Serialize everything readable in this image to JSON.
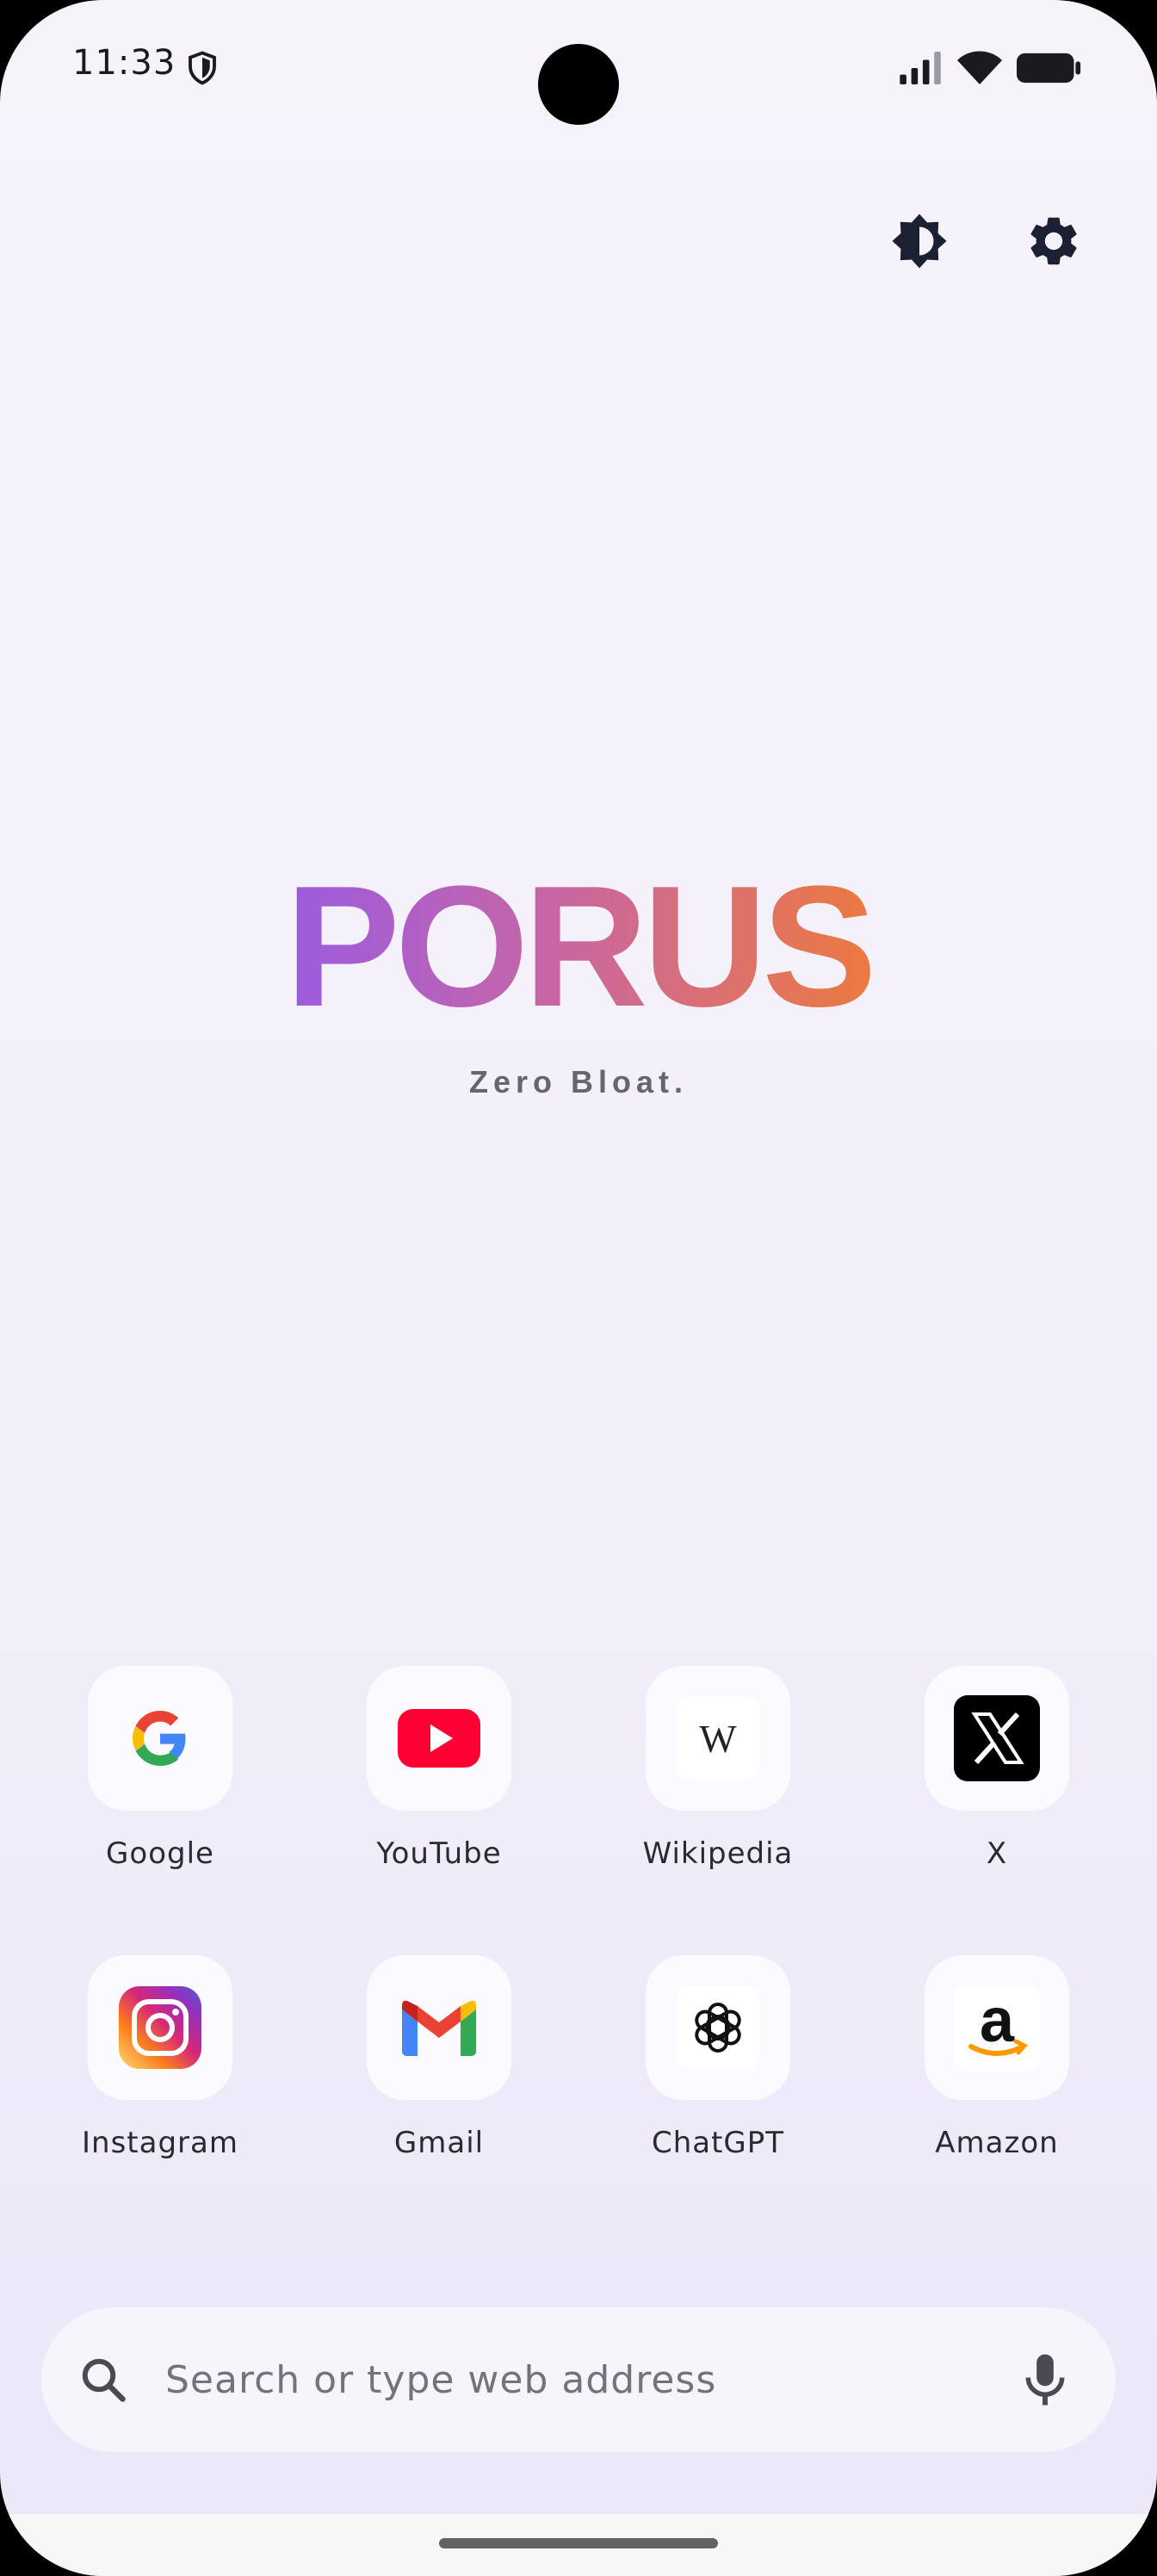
{
  "status_bar": {
    "time": "11:33"
  },
  "brand": {
    "title": "PORUS",
    "tagline": "Zero Bloat."
  },
  "shortcuts": [
    {
      "label": "Google",
      "icon": "google-icon"
    },
    {
      "label": "YouTube",
      "icon": "youtube-icon"
    },
    {
      "label": "Wikipedia",
      "icon": "wikipedia-icon"
    },
    {
      "label": "X",
      "icon": "x-icon"
    },
    {
      "label": "Instagram",
      "icon": "instagram-icon"
    },
    {
      "label": "Gmail",
      "icon": "gmail-icon"
    },
    {
      "label": "ChatGPT",
      "icon": "chatgpt-icon"
    },
    {
      "label": "Amazon",
      "icon": "amazon-icon"
    }
  ],
  "search": {
    "placeholder": "Search or type web address",
    "value": ""
  },
  "colors": {
    "brand_start": "#9b5be0",
    "brand_end": "#ec7a40",
    "background": "#f3f0fa"
  }
}
